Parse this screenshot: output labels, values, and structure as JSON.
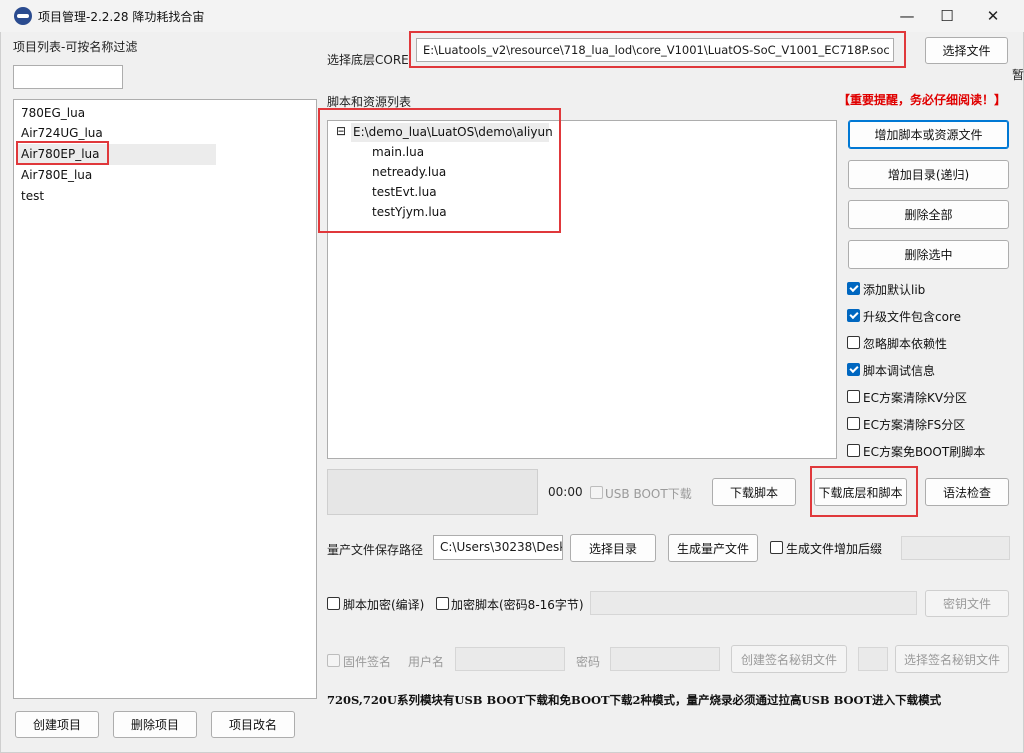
{
  "window": {
    "title": "项目管理-2.2.28 降功耗找合宙",
    "controls": {
      "minimize": "—",
      "maximize": "☐",
      "close": "✕"
    },
    "edge_text": "暂"
  },
  "left": {
    "filter_label": "项目列表-可按名称过滤",
    "filter_value": "",
    "projects": [
      "780EG_lua",
      "Air724UG_lua",
      "Air780EP_lua",
      "Air780E_lua",
      "test"
    ],
    "selected_index": 2,
    "buttons": {
      "create": "创建项目",
      "delete": "删除项目",
      "rename": "项目改名"
    }
  },
  "core": {
    "label": "选择底层CORE",
    "path": "E:\\Luatools_v2\\resource\\718_lua_lod\\core_V1001\\LuatOS-SoC_V1001_EC718P.soc",
    "select_button": "选择文件"
  },
  "scripts": {
    "label": "脚本和资源列表",
    "warning": "【重要提醒，务必仔细阅读！】",
    "tree_expander": "⊟",
    "root": "E:\\demo_lua\\LuatOS\\demo\\aliyun",
    "files": [
      "main.lua",
      "netready.lua",
      "testEvt.lua",
      "testYjym.lua"
    ]
  },
  "side_buttons": {
    "add_script": "增加脚本或资源文件",
    "add_dir": "增加目录(递归)",
    "delete_all": "删除全部",
    "delete_selected": "删除选中"
  },
  "options": [
    {
      "label": "添加默认lib",
      "checked": true
    },
    {
      "label": "升级文件包含core",
      "checked": true
    },
    {
      "label": "忽略脚本依赖性",
      "checked": false
    },
    {
      "label": "脚本调试信息",
      "checked": true
    },
    {
      "label": "EC方案清除KV分区",
      "checked": false
    },
    {
      "label": "EC方案清除FS分区",
      "checked": false
    },
    {
      "label": "EC方案免BOOT刷脚本",
      "checked": false
    }
  ],
  "download": {
    "time": "00:00",
    "usb_boot_label": "USB BOOT下载",
    "download_script": "下载脚本",
    "download_core_script": "下载底层和脚本",
    "syntax_check": "语法检查"
  },
  "production": {
    "label": "量产文件保存路径",
    "path": "C:\\Users\\30238\\Desk",
    "select_dir": "选择目录",
    "generate": "生成量产文件",
    "suffix_label": "生成文件增加后缀",
    "suffix_value": ""
  },
  "encrypt": {
    "compile_label": "脚本加密(编译)",
    "encrypt_label": "加密脚本(密码8-16字节)",
    "key_value": "",
    "key_file": "密钥文件"
  },
  "sign": {
    "firmware_label": "固件签名",
    "user_label": "用户名",
    "password_label": "密码",
    "create_key": "创建签名秘钥文件",
    "select_key": "选择签名秘钥文件"
  },
  "footer_note": "720S,720U系列模块有USB BOOT下载和免BOOT下载2种模式，量产烧录必须通过拉高USB BOOT进入下载模式"
}
